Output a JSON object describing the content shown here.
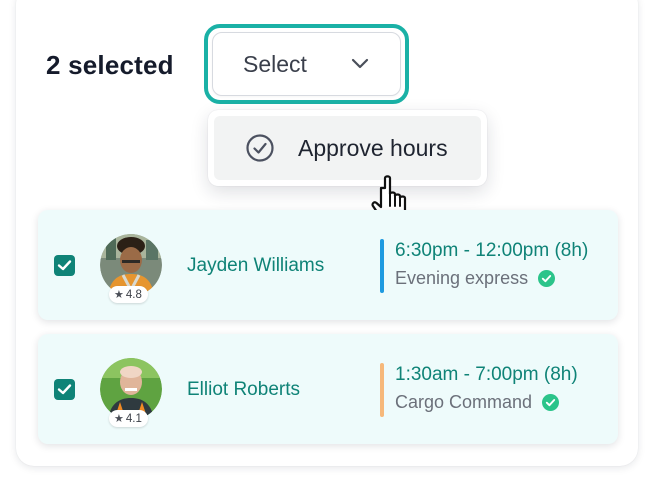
{
  "header": {
    "selected_count": "2 selected",
    "select_label": "Select"
  },
  "dropdown": {
    "items": [
      {
        "label": "Approve hours",
        "icon": "check-circle-icon"
      }
    ]
  },
  "shifts": [
    {
      "name": "Jayden Williams",
      "rating": "4.8",
      "time": "6:30pm - 12:00pm (8h)",
      "role": "Evening express",
      "bar_color": "#1e9ae0",
      "checked": true
    },
    {
      "name": "Elliot Roberts",
      "rating": "4.1",
      "time": "1:30am - 7:00pm (8h)",
      "role": "Cargo Command",
      "bar_color": "#f6b87a",
      "checked": true
    }
  ],
  "colors": {
    "accent": "#1ab1a6",
    "brand_text": "#0f8377",
    "verified": "#2bc48a"
  }
}
